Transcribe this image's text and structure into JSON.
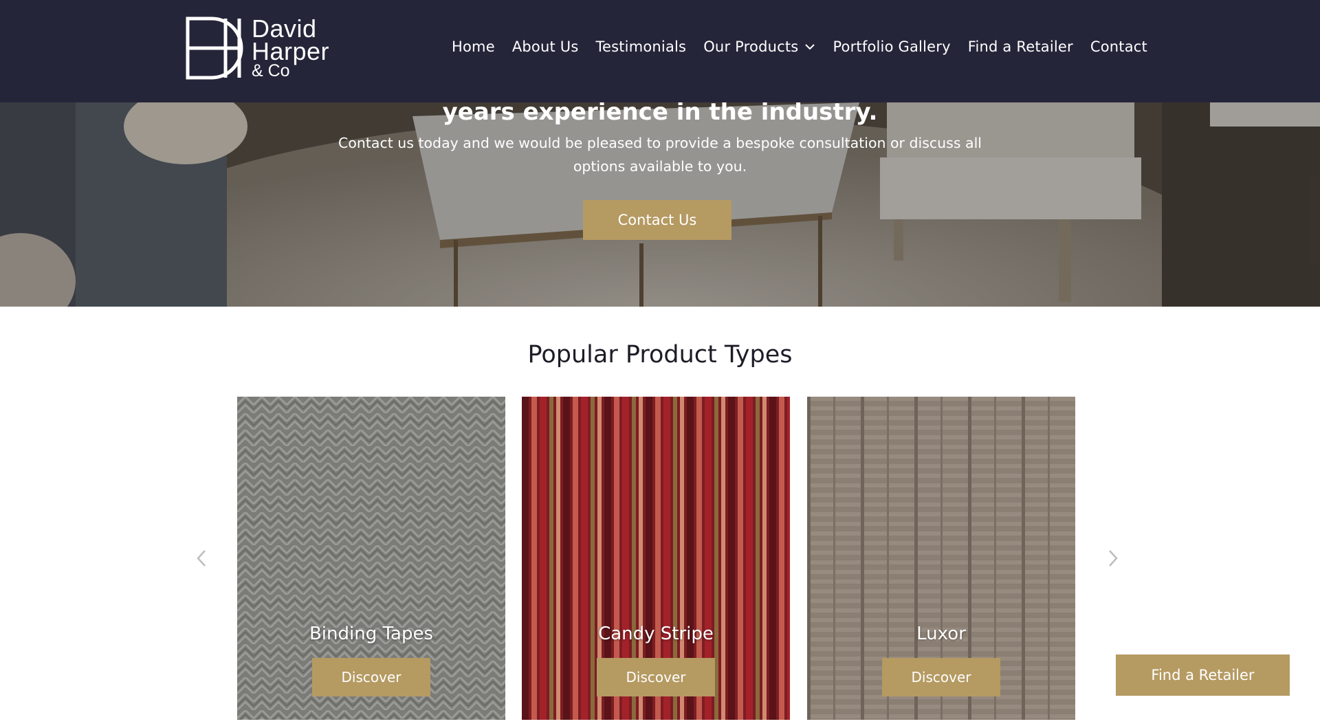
{
  "brand": {
    "line1": "David",
    "line2": "Harper",
    "line3": "& Co"
  },
  "nav": {
    "home": "Home",
    "about": "About Us",
    "testimonials": "Testimonials",
    "products": "Our Products",
    "portfolio": "Portfolio Gallery",
    "retailer": "Find a Retailer",
    "contact": "Contact"
  },
  "hero": {
    "headline": "years experience in the industry.",
    "subtext": "Contact us today and we would be pleased to provide a bespoke consultation or discuss all options available to you.",
    "button": "Contact Us"
  },
  "products": {
    "title": "Popular Product Types",
    "cards": [
      {
        "name": "Binding Tapes",
        "button": "Discover"
      },
      {
        "name": "Candy Stripe",
        "button": "Discover"
      },
      {
        "name": "Luxor",
        "button": "Discover"
      }
    ]
  },
  "floating_button": "Find a Retailer",
  "colors": {
    "header_bg": "#25253a",
    "accent_gold": "#b59a62",
    "title_text": "#1d1d28"
  },
  "icons": {
    "dropdown": "chevron-down-icon",
    "prev": "chevron-left-icon",
    "next": "chevron-right-icon"
  }
}
